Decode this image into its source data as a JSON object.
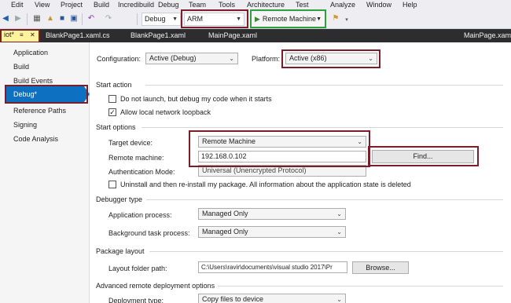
{
  "menu": [
    "Edit",
    "View",
    "Project",
    "Build",
    "Incredibuild",
    "Debug",
    "Team",
    "Tools",
    "Architecture",
    "Test",
    "Analyze",
    "Window",
    "Help"
  ],
  "toolbar": {
    "configuration": "Debug",
    "platform": "ARM",
    "run_target": "Remote Machine"
  },
  "tabs": {
    "active": "iot*",
    "pin": "≡",
    "close": "✕",
    "items": [
      "BlankPage1.xaml.cs",
      "BlankPage1.xaml",
      "MainPage.xaml"
    ],
    "right": "MainPage.xaml"
  },
  "nav": {
    "items": [
      "Application",
      "Build",
      "Build Events",
      "Debug*",
      "Reference Paths",
      "Signing",
      "Code Analysis"
    ],
    "selected_index": 3
  },
  "config": {
    "configuration_label": "Configuration:",
    "configuration_value": "Active (Debug)",
    "platform_label": "Platform:",
    "platform_value": "Active (x86)"
  },
  "start_action": {
    "heading": "Start action",
    "do_not_launch_label": "Do not launch, but debug my code when it starts",
    "do_not_launch_checked": false,
    "allow_loopback_label": "Allow local network loopback",
    "allow_loopback_checked": true
  },
  "start_options": {
    "heading": "Start options",
    "target_device_label": "Target device:",
    "target_device_value": "Remote Machine",
    "remote_machine_label": "Remote machine:",
    "remote_machine_value": "192.168.0.102",
    "find_label": "Find...",
    "auth_mode_label": "Authentication Mode:",
    "auth_mode_value": "Universal (Unencrypted Protocol)",
    "uninstall_label": "Uninstall and then re-install my package. All information about the application state is deleted",
    "uninstall_checked": false
  },
  "debugger_type": {
    "heading": "Debugger type",
    "app_process_label": "Application process:",
    "app_process_value": "Managed Only",
    "bg_task_label": "Background task process:",
    "bg_task_value": "Managed Only"
  },
  "package_layout": {
    "heading": "Package layout",
    "folder_label": "Layout folder path:",
    "folder_value": "C:\\Users\\ravir\\documents\\visual studio 2017\\Pr",
    "browse_label": "Browse..."
  },
  "advanced": {
    "heading": "Advanced remote deployment options",
    "deployment_type_label": "Deployment type:",
    "deployment_type_value": "Copy files to device"
  },
  "colors": {
    "highlight_box": "#7a1f2a",
    "run_box": "#2f9f3f",
    "selection": "#0e70c0",
    "active_tab": "#fff29d"
  }
}
